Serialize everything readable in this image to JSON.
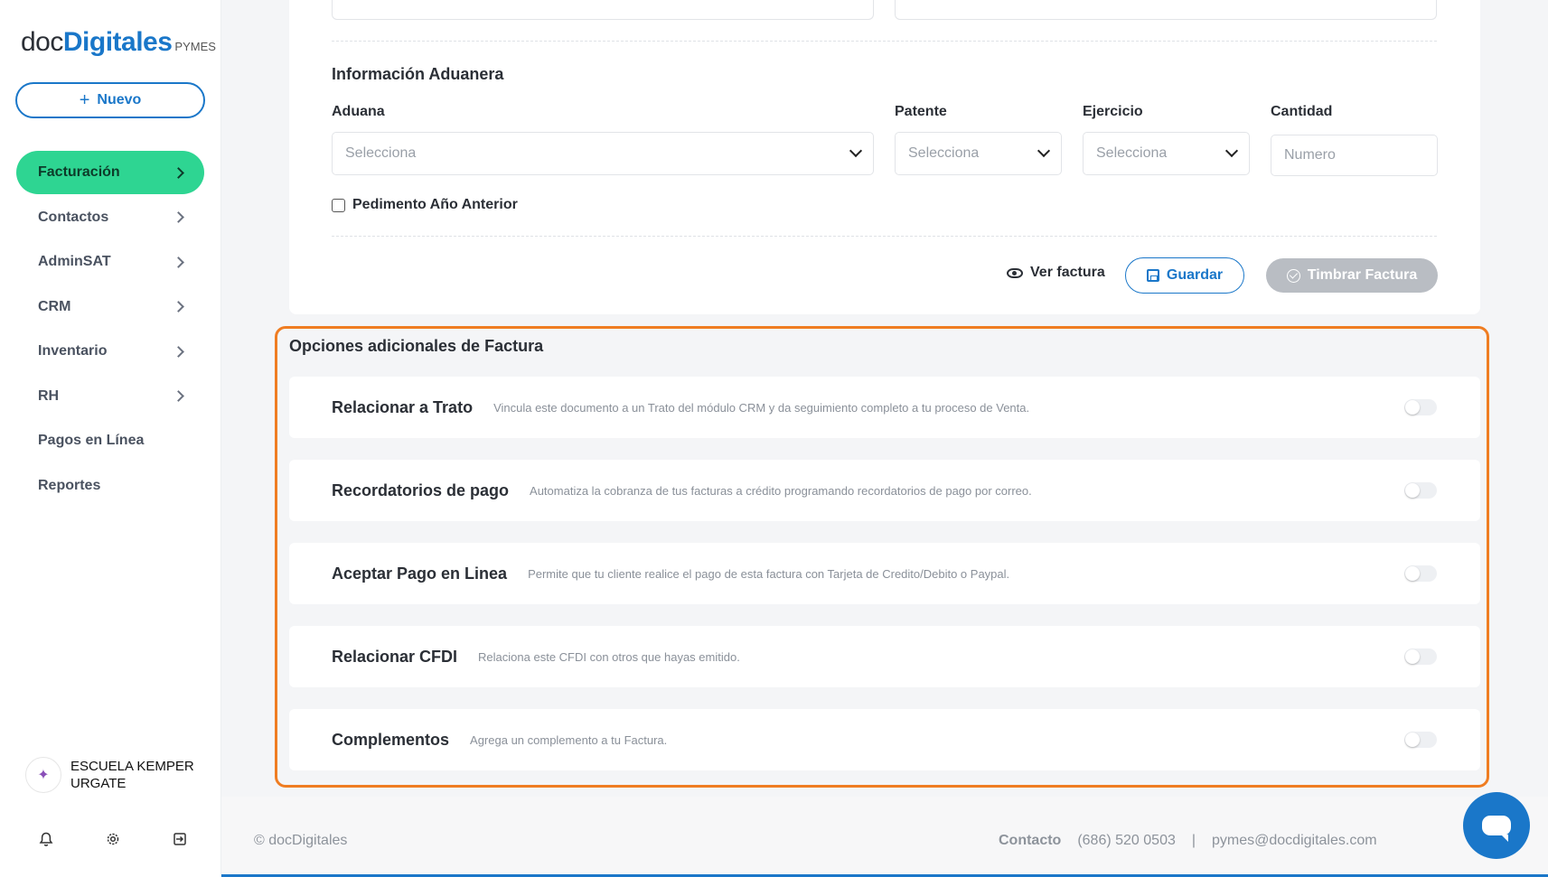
{
  "app": {
    "logo_doc": "doc",
    "logo_digitales": "Digitales",
    "logo_pymes": "PYMES",
    "new_button": "Nuevo"
  },
  "sidebar": {
    "items": [
      {
        "label": "Facturación",
        "active": true,
        "has_chevron": true
      },
      {
        "label": "Contactos",
        "active": false,
        "has_chevron": true
      },
      {
        "label": "AdminSAT",
        "active": false,
        "has_chevron": true
      },
      {
        "label": "CRM",
        "active": false,
        "has_chevron": true
      },
      {
        "label": "Inventario",
        "active": false,
        "has_chevron": true
      },
      {
        "label": "RH",
        "active": false,
        "has_chevron": true
      },
      {
        "label": "Pagos en Línea",
        "active": false,
        "has_chevron": false
      },
      {
        "label": "Reportes",
        "active": false,
        "has_chevron": false
      }
    ],
    "company": {
      "line1": "ESCUELA KEMPER",
      "line2": "URGATE"
    },
    "bottom_icons": [
      "bell-icon",
      "gear-icon",
      "logout-icon"
    ]
  },
  "customs": {
    "title": "Información Aduanera",
    "aduana": {
      "label": "Aduana",
      "value": "Selecciona"
    },
    "patente": {
      "label": "Patente",
      "value": "Selecciona"
    },
    "ejercicio": {
      "label": "Ejercicio",
      "value": "Selecciona"
    },
    "cantidad": {
      "label": "Cantidad",
      "placeholder": "Numero"
    },
    "checkbox_label": "Pedimento Año Anterior"
  },
  "actions": {
    "ver": "Ver factura",
    "guardar": "Guardar",
    "timbrar": "Timbrar Factura"
  },
  "options": {
    "title": "Opciones adicionales de Factura",
    "rows": [
      {
        "title": "Relacionar a Trato",
        "desc": "Vincula este documento a un Trato del módulo CRM y da seguimiento completo a tu proceso de Venta.",
        "enabled": false
      },
      {
        "title": "Recordatorios de pago",
        "desc": "Automatiza la cobranza de tus facturas a crédito programando recordatorios de pago por correo.",
        "enabled": false
      },
      {
        "title": "Aceptar Pago en Linea",
        "desc": "Permite que tu cliente realice el pago de esta factura con Tarjeta de Credito/Debito o Paypal.",
        "enabled": false
      },
      {
        "title": "Relacionar CFDI",
        "desc": "Relaciona este CFDI con otros que hayas emitido.",
        "enabled": false
      },
      {
        "title": "Complementos",
        "desc": "Agrega un complemento a tu Factura.",
        "enabled": false
      }
    ]
  },
  "footer": {
    "copyright": "© docDigitales",
    "contact_label": "Contacto",
    "phone": "(686) 520 0503",
    "separator": "|",
    "email": "pymes@docdigitales.com"
  },
  "colors": {
    "brand_blue": "#1a77c9",
    "active_green": "#2ed592",
    "highlight_orange": "#ef7d22",
    "disabled_gray": "#b9bdc3"
  }
}
